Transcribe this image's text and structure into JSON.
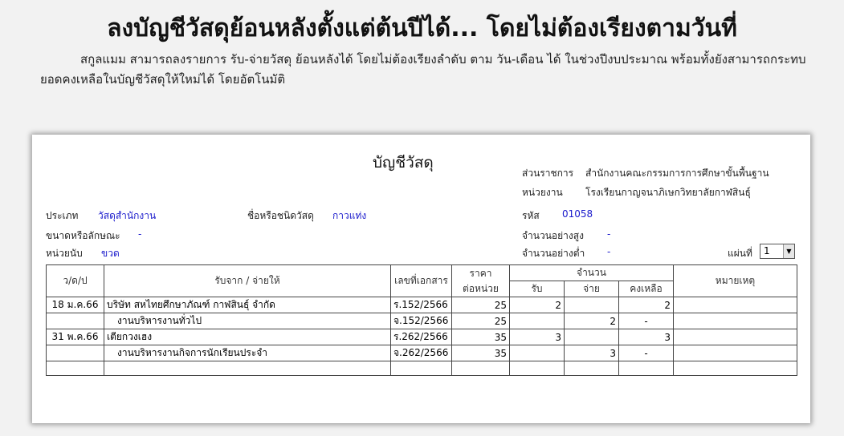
{
  "headline": "ลงบัญชีวัสดุย้อนหลังตั้งแต่ต้นปีได้... โดยไม่ต้องเรียงตามวันที่",
  "description": "สกูลแมม สามารถลงรายการ รับ-จ่ายวัสดุ ย้อนหลังได้ โดยไม่ต้องเรียงลำดับ ตาม วัน-เดือน ได้ ในช่วงปีงบประมาณ พร้อมทั้งยังสามารถกระทบยอดคงเหลือในบัญชีวัสดุให้ใหม่ได้ โดยอัตโนมัติ",
  "sheet": {
    "title": "บัญชีวัสดุ",
    "agency_label": "ส่วนราชการ",
    "agency_value": "สำนักงานคณะกรรมการการศึกษาขั้นพื้นฐาน",
    "unit_label": "หน่วยงาน",
    "unit_value": "โรงเรียนกาญจนาภิเษกวิทยาลัยกาฬสินธุ์",
    "type_label": "ประเภท",
    "type_value": "วัสดุสำนักงาน",
    "name_label": "ชื่อหรือชนิดวัสดุ",
    "name_value": "กาวแท่ง",
    "code_label": "รหัส",
    "code_value": "01058",
    "size_label": "ขนาดหรือลักษณะ",
    "size_value": "-",
    "max_label": "จำนวนอย่างสูง",
    "max_value": "-",
    "uom_label": "หน่วยนับ",
    "uom_value": "ขวด",
    "min_label": "จำนวนอย่างต่ำ",
    "min_value": "-",
    "page_label": "แผ่นที่",
    "page_value": "1",
    "page_arrow": "▼"
  },
  "table": {
    "headers": {
      "date": "ว/ด/ป",
      "from_to": "รับจาก / จ่ายให้",
      "doc_no": "เลขที่เอกสาร",
      "price_line1": "ราคา",
      "price_line2": "ต่อหน่วย",
      "qty": "จำนวน",
      "receive": "รับ",
      "pay": "จ่าย",
      "balance": "คงเหลือ",
      "remark": "หมายเหตุ"
    },
    "rows": [
      {
        "date": "18 ม.ค.66",
        "party": "บริษัท สหไทยศึกษาภัณฑ์ กาฬสินธุ์ จำกัด",
        "doc": "ร.152/2566",
        "price": "25",
        "receive": "2",
        "pay": "",
        "balance": "2",
        "remark": ""
      },
      {
        "date": "",
        "party": "งานบริหารงานทั่วไป",
        "doc": "จ.152/2566",
        "price": "25",
        "receive": "",
        "pay": "2",
        "balance": "-",
        "remark": ""
      },
      {
        "date": "31 พ.ค.66",
        "party": "เตียกวงเฮง",
        "doc": "ร.262/2566",
        "price": "35",
        "receive": "3",
        "pay": "",
        "balance": "3",
        "remark": ""
      },
      {
        "date": "",
        "party": "งานบริหารงานกิจการนักเรียนประจำ",
        "doc": "จ.262/2566",
        "price": "35",
        "receive": "",
        "pay": "3",
        "balance": "-",
        "remark": ""
      }
    ]
  }
}
